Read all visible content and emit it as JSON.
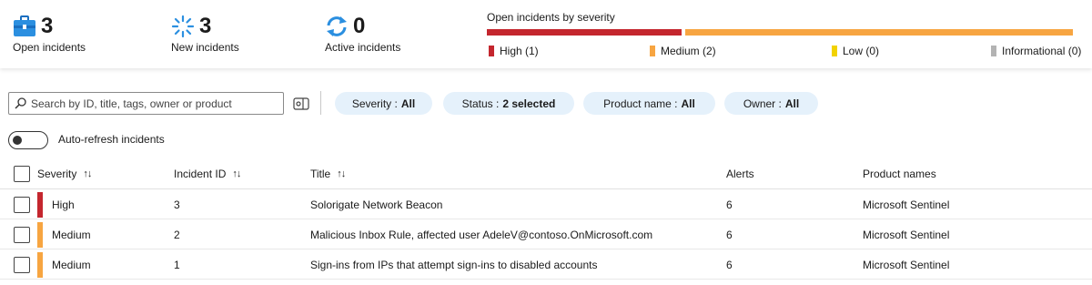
{
  "summary": {
    "open": {
      "count": "3",
      "label": "Open incidents"
    },
    "new": {
      "count": "3",
      "label": "New incidents"
    },
    "active": {
      "count": "0",
      "label": "Active incidents"
    }
  },
  "severity_chart": {
    "title": "Open incidents by severity",
    "legend": [
      {
        "label": "High (1)",
        "color": "#c4262e",
        "count": 1
      },
      {
        "label": "Medium (2)",
        "color": "#f7a541",
        "count": 2
      },
      {
        "label": "Low (0)",
        "color": "#f2d200",
        "count": 0
      },
      {
        "label": "Informational (0)",
        "color": "#b3b3b3",
        "count": 0
      }
    ]
  },
  "filters": {
    "search_placeholder": "Search by ID, title, tags, owner or product",
    "pills": [
      {
        "key": "Severity :",
        "value": "All"
      },
      {
        "key": "Status :",
        "value": "2 selected"
      },
      {
        "key": "Product name :",
        "value": "All"
      },
      {
        "key": "Owner :",
        "value": "All"
      }
    ]
  },
  "auto_refresh": {
    "label": "Auto-refresh incidents",
    "enabled": false
  },
  "table": {
    "columns": [
      "Severity",
      "Incident ID",
      "Title",
      "Alerts",
      "Product names"
    ],
    "sort_glyph": "↑↓",
    "rows": [
      {
        "severity": "High",
        "severity_color": "#c4262e",
        "id": "3",
        "title": "Solorigate Network Beacon",
        "alerts": "6",
        "product": "Microsoft Sentinel"
      },
      {
        "severity": "Medium",
        "severity_color": "#f7a541",
        "id": "2",
        "title": "Malicious Inbox Rule, affected user AdeleV@contoso.OnMicrosoft.com",
        "alerts": "6",
        "product": "Microsoft Sentinel"
      },
      {
        "severity": "Medium",
        "severity_color": "#f7a541",
        "id": "1",
        "title": "Sign-ins from IPs that attempt sign-ins to disabled accounts",
        "alerts": "6",
        "product": "Microsoft Sentinel"
      }
    ]
  }
}
